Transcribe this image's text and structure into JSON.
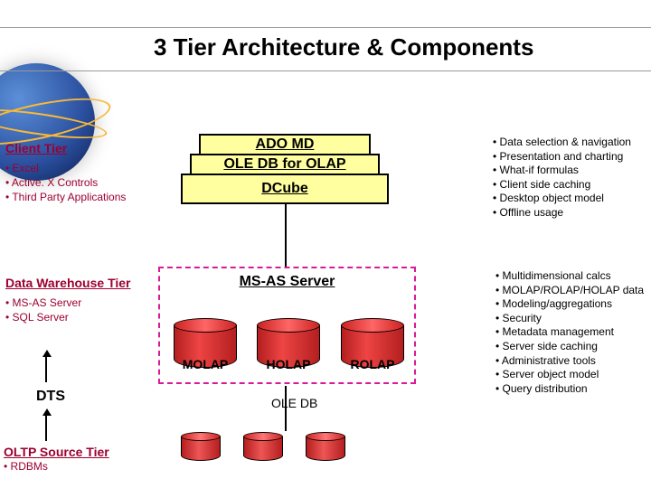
{
  "title": "3 Tier Architecture & Components",
  "client_tier": {
    "heading": "Client Tier",
    "items": [
      "Excel",
      "Active. X Controls",
      "Third Party Applications"
    ]
  },
  "client_stack": {
    "top": "ADO MD",
    "mid": "OLE DB for OLAP",
    "bot": "DCube"
  },
  "client_right": [
    "Data selection & navigation",
    "Presentation and charting",
    "What-if formulas",
    "Client side caching",
    "Desktop object model",
    "Offline usage"
  ],
  "warehouse": {
    "heading": "Data Warehouse Tier",
    "items": [
      "MS-AS Server",
      "SQL Server"
    ],
    "box_title": "MS-AS Server",
    "cyls": [
      "MOLAP",
      "HOLAP",
      "ROLAP"
    ]
  },
  "warehouse_right": [
    "Multidimensional calcs",
    "MOLAP/ROLAP/HOLAP data",
    "Modeling/aggregations",
    "Security",
    "Metadata management",
    "Server side caching",
    "Administrative tools",
    "Server object model",
    "Query distribution"
  ],
  "dts_label": "DTS",
  "oledb_label": "OLE DB",
  "oltp": {
    "heading": "OLTP Source Tier",
    "items": [
      "RDBMs"
    ]
  }
}
